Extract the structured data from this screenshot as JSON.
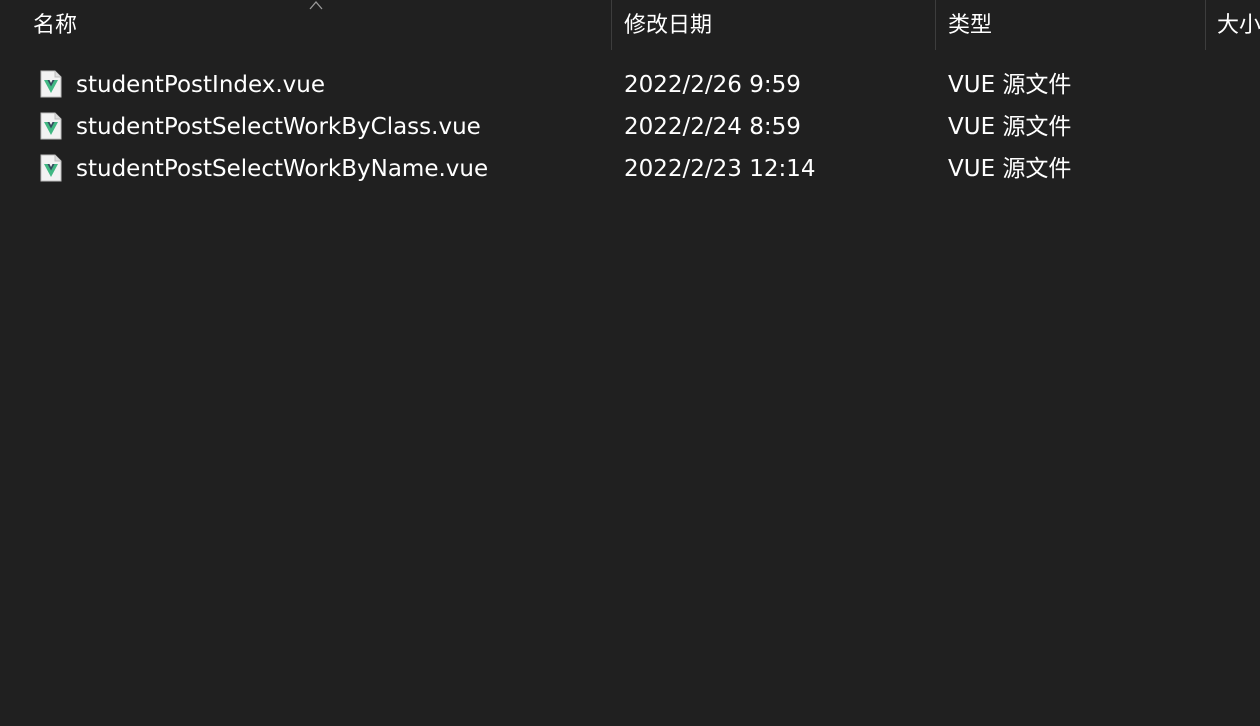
{
  "columns": {
    "name": "名称",
    "date": "修改日期",
    "type": "类型",
    "size": "大小"
  },
  "sort": {
    "icon": "chevron-up-icon"
  },
  "files": [
    {
      "name": "studentPostIndex.vue",
      "date": "2022/2/26 9:59",
      "type": "VUE 源文件",
      "icon": "vue-file-icon"
    },
    {
      "name": "studentPostSelectWorkByClass.vue",
      "date": "2022/2/24 8:59",
      "type": "VUE 源文件",
      "icon": "vue-file-icon"
    },
    {
      "name": "studentPostSelectWorkByName.vue",
      "date": "2022/2/23 12:14",
      "type": "VUE 源文件",
      "icon": "vue-file-icon"
    }
  ],
  "colors": {
    "background": "#202020",
    "divider": "#3d3d3d",
    "text": "#ffffff",
    "vue_green": "#41b883",
    "vue_dark": "#35495e"
  }
}
